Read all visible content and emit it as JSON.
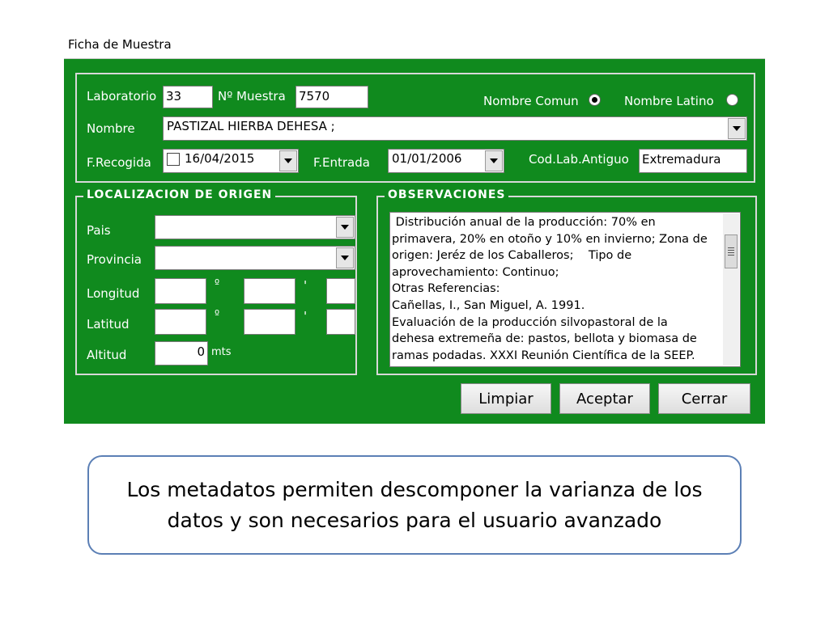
{
  "window": {
    "title": "Ficha de Muestra"
  },
  "header": {
    "laboratorio_label": "Laboratorio",
    "laboratorio_value": "33",
    "muestra_label": "Nº Muestra",
    "muestra_value": "7570",
    "nombre_comun_label": "Nombre Comun",
    "nombre_latino_label": "Nombre Latino",
    "nombre_label": "Nombre",
    "nombre_value": "PASTIZAL HIERBA DEHESA ;",
    "frecogida_label": "F.Recogida",
    "frecogida_value": "16/04/2015",
    "fentrada_label": "F.Entrada",
    "fentrada_value": "01/01/2006",
    "codlab_label": "Cod.Lab.Antiguo",
    "codlab_value": "Extremadura"
  },
  "localizacion": {
    "title": "LOCALIZACION DE ORIGEN",
    "pais_label": "Pais",
    "provincia_label": "Provincia",
    "longitud_label": "Longitud",
    "latitud_label": "Latitud",
    "altitud_label": "Altitud",
    "altitud_value": "0",
    "altitud_unit": "mts",
    "degree_symbol": "º",
    "minute_symbol": "'"
  },
  "observaciones": {
    "title": "OBSERVACIONES",
    "text": " Distribución anual de la producción: 70% en\nprimavera, 20% en otoño y 10% en invierno; Zona de\norigen: Jeréz de los Caballeros;    Tipo de\naprovechamiento: Continuo;\nOtras Referencias:\nCañellas, I., San Miguel, A. 1991.\nEvaluación de la producción silvopastoral de la\ndehesa extremeña de: pastos, bellota y biomasa de\nramas podadas. XXXI Reunión Científica de la SEEP."
  },
  "buttons": {
    "limpiar": "Limpiar",
    "aceptar": "Aceptar",
    "cerrar": "Cerrar"
  },
  "caption": {
    "text": "Los metadatos permiten descomponer la varianza de los datos y son necesarios para el usuario avanzado"
  },
  "colors": {
    "window_bg": "#108a1e",
    "caption_border": "#5b7fb5"
  }
}
